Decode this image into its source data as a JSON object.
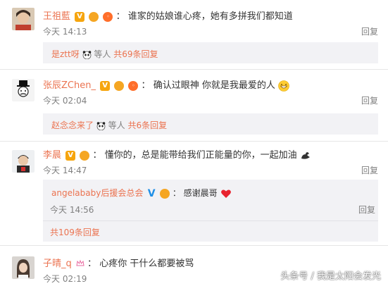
{
  "comments": [
    {
      "username": "王祖藍",
      "text": "谁家的姑娘谁心疼，她有多拼我们都知道",
      "time": "今天 14:13",
      "reply_label": "回复",
      "sub": {
        "user": "是ztt呀",
        "middle": "等人",
        "count": "共69条回复"
      }
    },
    {
      "username": "张辰ZChen_",
      "text": "确认过眼神 你就是我最爱的人",
      "time": "今天 02:04",
      "reply_label": "回复",
      "sub": {
        "user": "赵念念来了",
        "middle": "等人",
        "count": "共6条回复"
      }
    },
    {
      "username": "李晨",
      "text": "懂你的，总是能带给我们正能量的你，一起加油",
      "time": "今天 14:47",
      "reply_label": "回复",
      "nested": {
        "username": "angelababy后援会总会",
        "text": "感谢晨哥",
        "time": "今天 14:56",
        "reply_label": "回复"
      },
      "more": "共109条回复"
    },
    {
      "username": "子晴_q",
      "text": "心疼你 干什么都要被骂",
      "time": "今天 02:19",
      "reply_label": "回复"
    }
  ],
  "watermark": "头条号 / 我是太阳会发光",
  "colors": {
    "link": "#eb7350",
    "meta": "#808080",
    "panel": "#f2f2f5"
  }
}
